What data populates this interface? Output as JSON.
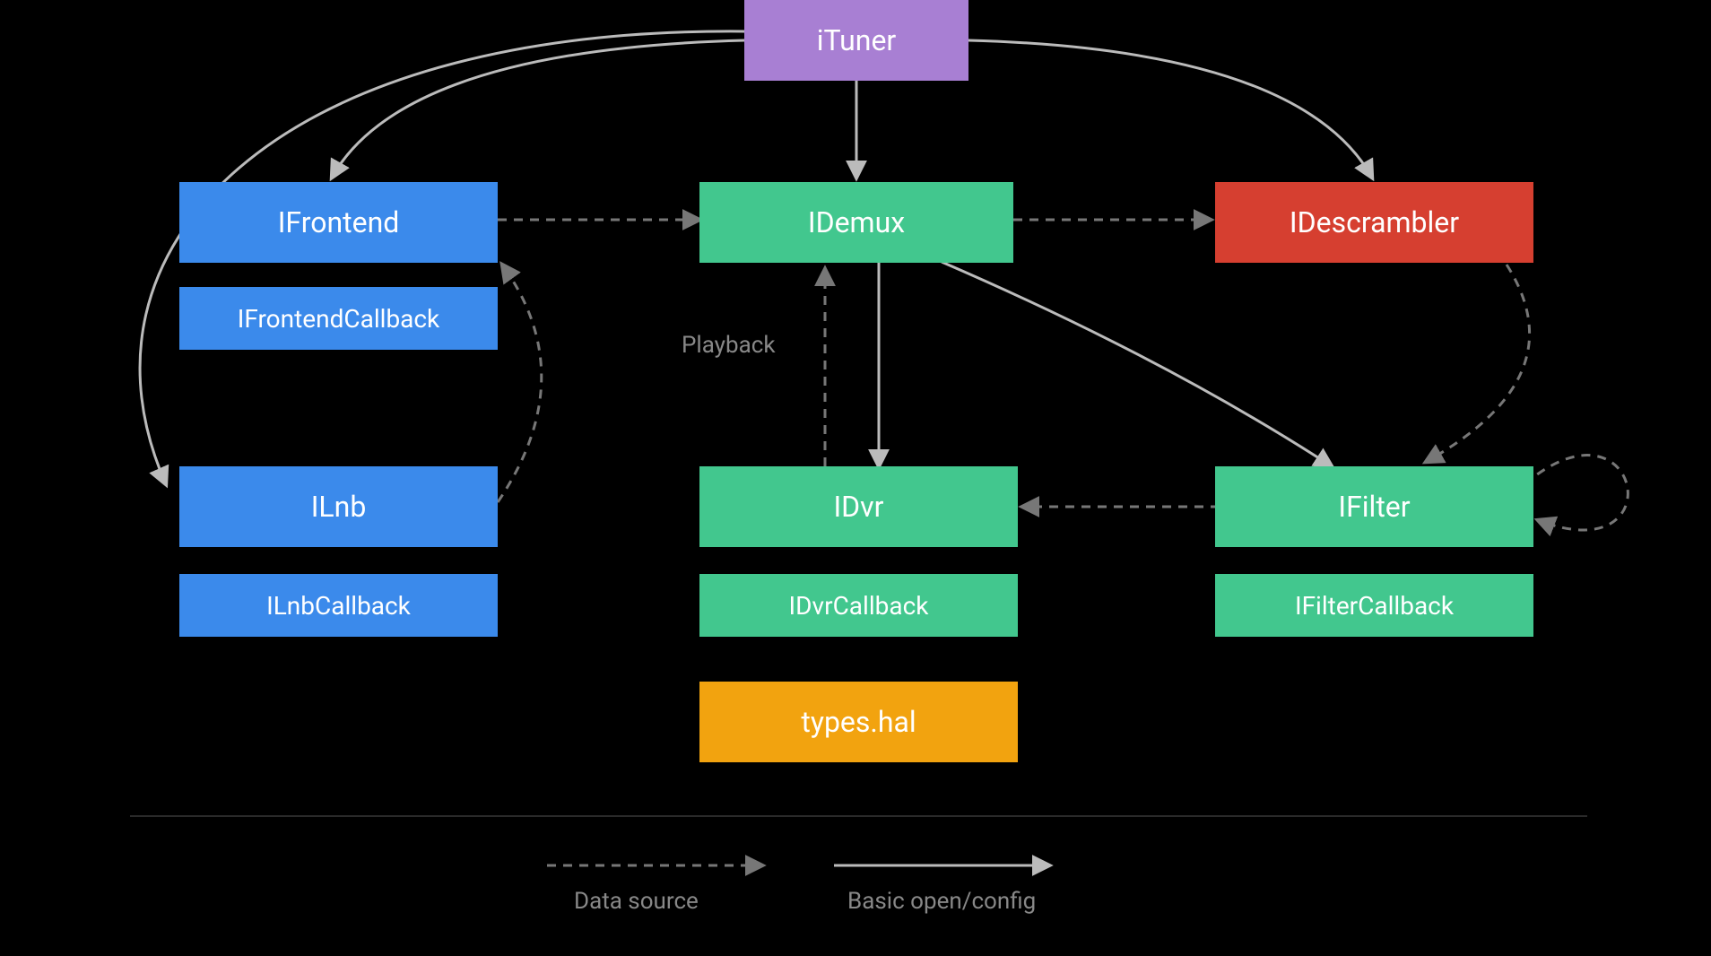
{
  "nodes": {
    "ituner": "iTuner",
    "ifrontend": "IFrontend",
    "ifrontendcallback": "IFrontendCallback",
    "idemux": "IDemux",
    "idescrambler": "IDescrambler",
    "ilnb": "ILnb",
    "ilnbcallback": "ILnbCallback",
    "idvr": "IDvr",
    "idvrcallback": "IDvrCallback",
    "ifilter": "IFilter",
    "ifiltercallback": "IFilterCallback",
    "typeshal": "types.hal"
  },
  "labels": {
    "playback": "Playback"
  },
  "legend": {
    "datasource": "Data source",
    "basic": "Basic open/config"
  },
  "colors": {
    "purple": "#A87FD3",
    "blue": "#3B8AEB",
    "green": "#42C78E",
    "red": "#D63F30",
    "orange": "#F2A30F",
    "arrow_solid": "#BBBBBB",
    "arrow_dashed": "#777777",
    "text_muted": "#888888"
  },
  "diagram": {
    "description": "Tuner HAL interface package diagram",
    "edges_solid": [
      {
        "from": "iTuner",
        "to": "IFrontend"
      },
      {
        "from": "iTuner",
        "to": "IDemux"
      },
      {
        "from": "iTuner",
        "to": "IDescrambler"
      },
      {
        "from": "iTuner",
        "to": "ILnb"
      },
      {
        "from": "IDemux",
        "to": "IDvr"
      },
      {
        "from": "IDemux",
        "to": "IFilter"
      }
    ],
    "edges_dashed": [
      {
        "from": "IFrontend",
        "to": "IDemux"
      },
      {
        "from": "IDemux",
        "to": "IDescrambler"
      },
      {
        "from": "ILnb",
        "to": "IFrontend"
      },
      {
        "from": "IDvr",
        "to": "IDemux",
        "label": "Playback"
      },
      {
        "from": "IFilter",
        "to": "IDvr"
      },
      {
        "from": "IFilter",
        "to": "IFilter",
        "note": "self-loop"
      },
      {
        "from": "IDescrambler",
        "to": "IFilter"
      }
    ]
  }
}
